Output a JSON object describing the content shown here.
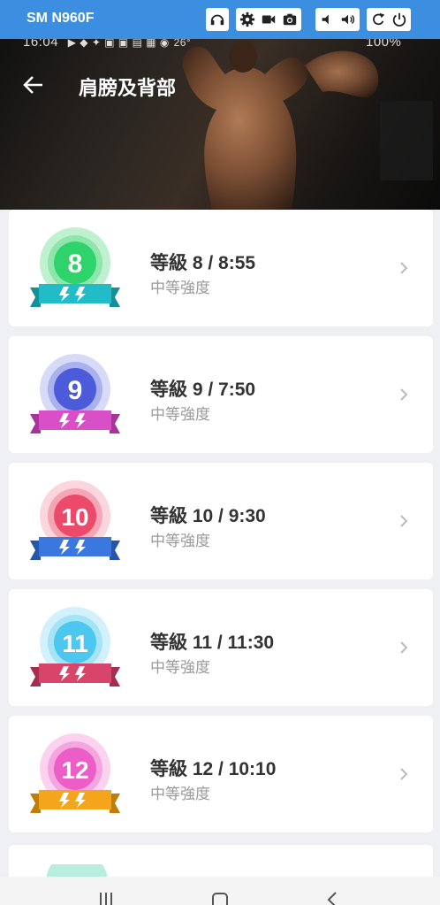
{
  "device": {
    "name": "SM N960F"
  },
  "status_bar": {
    "time": "16:04",
    "temp": "26°",
    "battery": "100%"
  },
  "header": {
    "title": "肩膀及背部"
  },
  "levels": [
    {
      "label": "等級 8 / 8:55",
      "number": "8",
      "intensity": "中等強度",
      "colors": {
        "outer": "#bff0cf",
        "mid": "#8fe6ab",
        "inner": "#2fd36b",
        "ribbon": "#22bcc8",
        "ribbon_dark": "#168f99"
      }
    },
    {
      "label": "等級 9 / 7:50",
      "number": "9",
      "intensity": "中等強度",
      "colors": {
        "outer": "#d7dbf7",
        "mid": "#a9b1ee",
        "inner": "#4b5bd9",
        "ribbon": "#d94fc7",
        "ribbon_dark": "#a8349a"
      }
    },
    {
      "label": "等級 10 / 9:30",
      "number": "10",
      "intensity": "中等強度",
      "colors": {
        "outer": "#fbd6de",
        "mid": "#f6a5b5",
        "inner": "#ec4a6a",
        "ribbon": "#3a78e0",
        "ribbon_dark": "#2656a8"
      }
    },
    {
      "label": "等級 11 / 11:30",
      "number": "11",
      "intensity": "中等強度",
      "colors": {
        "outer": "#d3f1fb",
        "mid": "#a5e3f6",
        "inner": "#4cc7ef",
        "ribbon": "#d9456a",
        "ribbon_dark": "#a32f4f"
      }
    },
    {
      "label": "等級 12 / 10:10",
      "number": "12",
      "intensity": "中等強度",
      "colors": {
        "outer": "#fbd3ef",
        "mid": "#f5a6df",
        "inner": "#ec5dc8",
        "ribbon": "#f4a51c",
        "ribbon_dark": "#c07d0a"
      }
    }
  ]
}
